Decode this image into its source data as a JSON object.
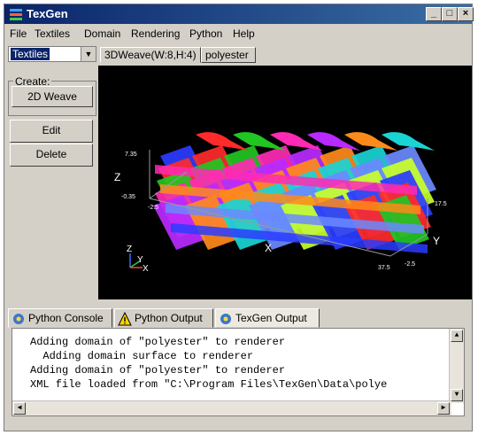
{
  "window": {
    "title": "TexGen"
  },
  "title_buttons": [
    "_",
    "□",
    "×"
  ],
  "menu": [
    {
      "label": "File"
    },
    {
      "label": "Textiles"
    },
    {
      "label": "Domain"
    },
    {
      "label": "Rendering"
    },
    {
      "label": "Python"
    },
    {
      "label": "Help"
    }
  ],
  "selector": {
    "value": "Textiles"
  },
  "view_tabs": [
    {
      "label": "3DWeave(W:8,H:4)",
      "active": true
    },
    {
      "label": "polyester",
      "active": false
    }
  ],
  "left_panel": {
    "group_label": "Create:",
    "create_button": "2D Weave",
    "edit_button": "Edit",
    "delete_button": "Delete"
  },
  "viewport": {
    "z_axis_label": "Z",
    "x_axis_label": "X",
    "y_axis_label": "Y",
    "z_tick_top": "7.35",
    "z_tick_bottom": "-0.35",
    "x_tick_start": "-2.5",
    "x_tick_end": "37.5",
    "y_tick_end": "17.5",
    "y_tick_start": "-2.5",
    "gizmo_z": "Z",
    "gizmo_y": "Y",
    "gizmo_x": "X"
  },
  "bottom_tabs": [
    {
      "label": "Python Console",
      "icon": "python-icon"
    },
    {
      "label": "Python Output",
      "icon": "warning-icon"
    },
    {
      "label": "TexGen Output",
      "icon": "python-icon",
      "active": true
    }
  ],
  "console_lines": [
    "Adding domain of \"polyester\" to renderer",
    "  Adding domain surface to renderer",
    "Adding domain of \"polyester\" to renderer",
    "XML file loaded from \"C:\\Program Files\\TexGen\\Data\\polye"
  ],
  "colors": {
    "titlebar": "#0a246a",
    "viewport_bg": "#000000",
    "yarn_colors": [
      "#2a3cff",
      "#ff2a2a",
      "#22c622",
      "#ff2ab4",
      "#b82aff",
      "#ff8a1a",
      "#1ad4d4",
      "#6a8aff",
      "#c8ff2a"
    ]
  }
}
